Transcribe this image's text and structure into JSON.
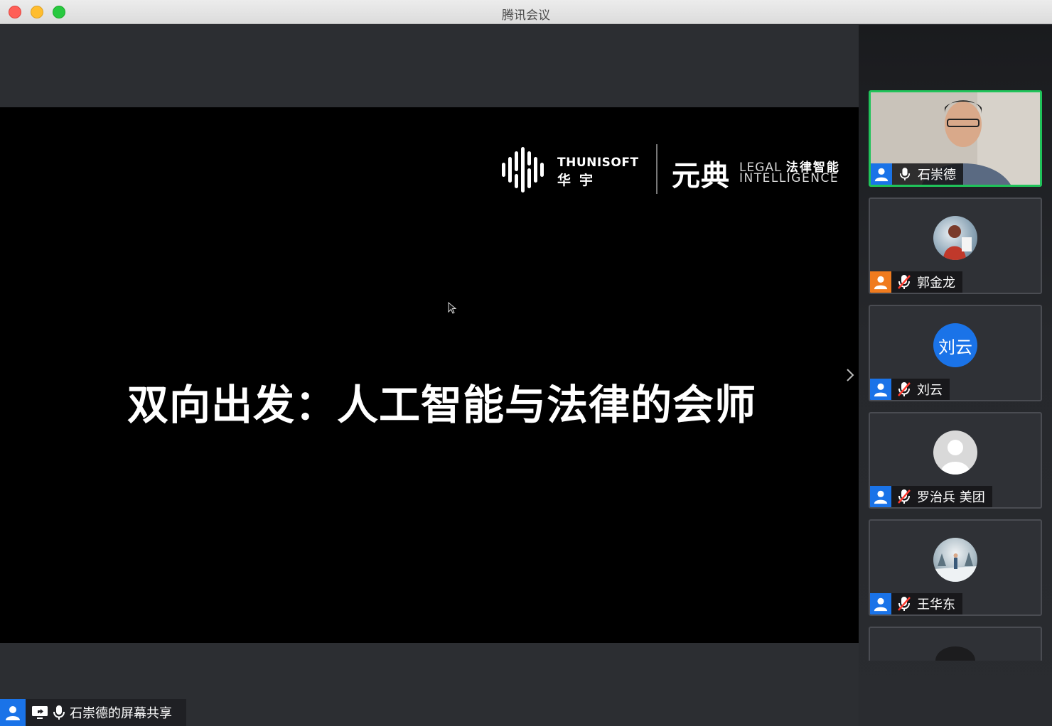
{
  "window": {
    "title": "腾讯会议"
  },
  "slide": {
    "brand_en": "THUNISOFT",
    "brand_cn": "华宇",
    "brand_product": "元典",
    "brand_legal_en": "LEGAL",
    "brand_legal_cn": "法律智能",
    "brand_intelligence": "INTELLIGENCE",
    "title": "双向出发：人工智能与法律的会师"
  },
  "share_label": {
    "text": "石崇德的屏幕共享"
  },
  "participants": [
    {
      "name": "石崇德",
      "mic": "on",
      "role_color": "#1a73e8",
      "avatar": "video"
    },
    {
      "name": "郭金龙",
      "mic": "muted",
      "role_color": "#f07b1e",
      "avatar": "photo"
    },
    {
      "name": "刘云",
      "mic": "muted",
      "role_color": "#1a73e8",
      "avatar": "text",
      "avatar_text": "刘云"
    },
    {
      "name": "罗治兵 美团",
      "mic": "muted",
      "role_color": "#1a73e8",
      "avatar": "default"
    },
    {
      "name": "王华东",
      "mic": "muted",
      "role_color": "#1a73e8",
      "avatar": "photo"
    }
  ],
  "colors": {
    "active_speaker_border": "#20c35a",
    "accent_blue": "#1a73e8",
    "host_orange": "#f07b1e"
  }
}
